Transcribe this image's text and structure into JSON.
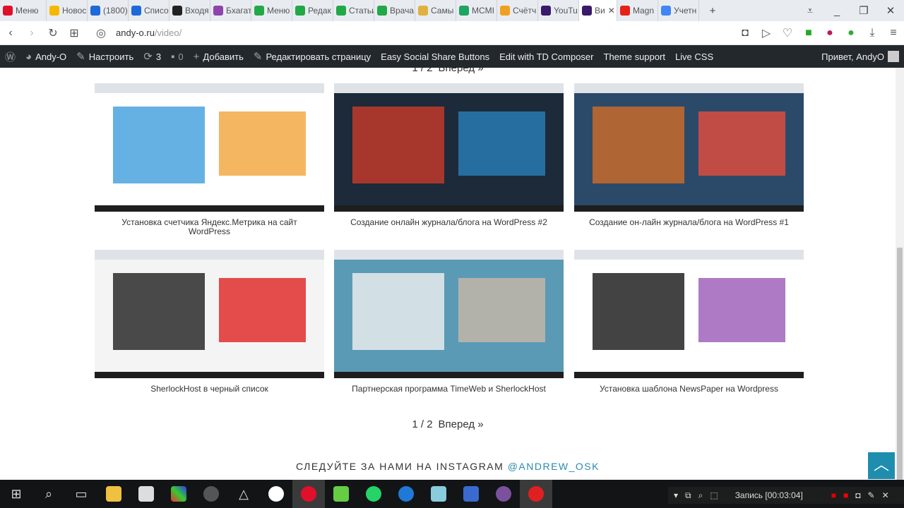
{
  "tabs": [
    {
      "label": "Меню",
      "color": "#e0102b"
    },
    {
      "label": "Новос",
      "color": "#f5b800"
    },
    {
      "label": "(1800)",
      "color": "#1e6ad8"
    },
    {
      "label": "Списо",
      "color": "#1e6ad8"
    },
    {
      "label": "Входя",
      "color": "#222"
    },
    {
      "label": "Бхагат",
      "color": "#8e44ad"
    },
    {
      "label": "Меню",
      "color": "#22a846"
    },
    {
      "label": "Редак",
      "color": "#22a846"
    },
    {
      "label": "Статьи",
      "color": "#22a846"
    },
    {
      "label": "Врача",
      "color": "#22a846"
    },
    {
      "label": "Самы",
      "color": "#e0b040"
    },
    {
      "label": "MCMI",
      "color": "#1fa463"
    },
    {
      "label": "Счётч",
      "color": "#f0a020"
    },
    {
      "label": "YouTu",
      "color": "#3a1a6a"
    },
    {
      "label": "Ви",
      "color": "#3a1a6a",
      "active": true
    },
    {
      "label": "Magn",
      "color": "#e62117"
    },
    {
      "label": "Учетн",
      "color": "#4285f4"
    }
  ],
  "address": {
    "host": "andy-o.ru",
    "path": "/video/"
  },
  "adminbar": {
    "site": "Andy-O",
    "customize": "Настроить",
    "updates": "3",
    "comments": "0",
    "add": "Добавить",
    "edit": "Редактировать страницу",
    "essb": "Easy Social Share Buttons",
    "td": "Edit with TD Composer",
    "theme": "Theme support",
    "css": "Live CSS",
    "greeting": "Привет, AndyO"
  },
  "pagination": {
    "pages": "1 / 2",
    "next": "Вперед »"
  },
  "videos": [
    {
      "title": "Установка счетчика Яндекс.Метрика на сайт WordPress",
      "colors": [
        "#ffffff",
        "#4aa3df",
        "#f2a43a"
      ]
    },
    {
      "title": "Создание онлайн журнала/блога на WordPress #2",
      "colors": [
        "#1d2a3a",
        "#c0392b",
        "#2980b9"
      ]
    },
    {
      "title": "Создание он-лайн журнала/блога на WordPress #1",
      "colors": [
        "#2b4a6a",
        "#c86a2a",
        "#e74c3c"
      ]
    },
    {
      "title": "SherlockHost в черный список",
      "colors": [
        "#f4f4f4",
        "#2a2a2a",
        "#e02020"
      ]
    },
    {
      "title": "Партнерская программа TimeWeb и SherlockHost",
      "colors": [
        "#5a9ab5",
        "#e8ecef",
        "#c8b8a8"
      ]
    },
    {
      "title": "Установка шаблона NewsPaper на Wordpress",
      "colors": [
        "#ffffff",
        "#222222",
        "#9b59b6"
      ]
    }
  ],
  "instagram": {
    "text": "СЛЕДУЙТЕ ЗА НАМИ НА INSTAGRAM",
    "handle": "@ANDREW_OSK"
  },
  "recorder": {
    "status": "Запись [00:03:04]"
  }
}
